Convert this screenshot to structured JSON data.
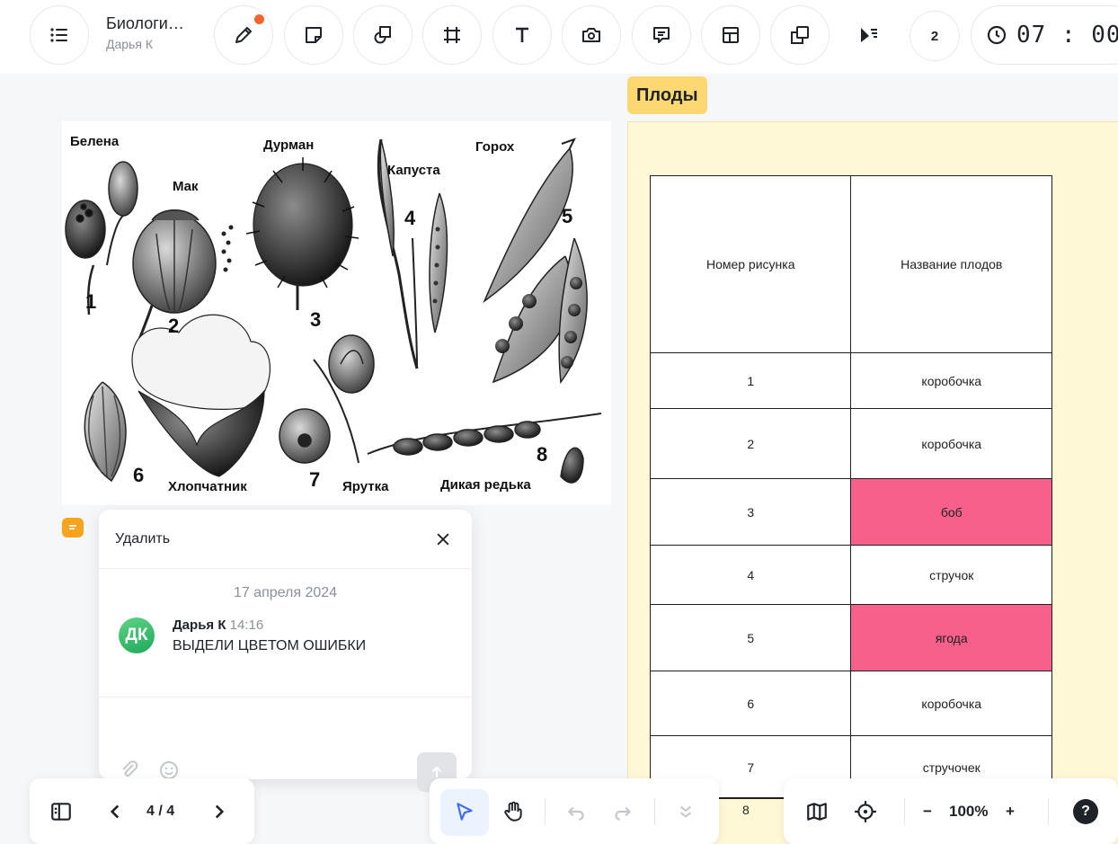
{
  "document": {
    "title": "Биологи…",
    "author": "Дарья К"
  },
  "toolbar": {
    "icons": [
      "menu-icon",
      "pen-icon",
      "sticky-note-icon",
      "shapes-icon",
      "frame-icon",
      "text-icon",
      "camera-icon",
      "comment-icon",
      "table-icon",
      "duplicate-icon",
      "presentation-icon"
    ],
    "count": "2",
    "timer": "07 : 00"
  },
  "image": {
    "labels": {
      "belena": "Белена",
      "mak": "Мак",
      "durman": "Дурман",
      "kapusta": "Капуста",
      "gorokh": "Горох",
      "khlopchatnik": "Хлопчатник",
      "yarutka": "Ярутка",
      "dikaya_redka": "Дикая редька"
    },
    "numbers": [
      "1",
      "2",
      "3",
      "4",
      "5",
      "6",
      "7",
      "8"
    ]
  },
  "frame": {
    "label": "Плоды",
    "table": {
      "headers": [
        "Номер рисунка",
        "Название плодов"
      ],
      "rows": [
        {
          "num": "1",
          "name": "коробочка",
          "highlight": false
        },
        {
          "num": "2",
          "name": "коробочка",
          "highlight": false
        },
        {
          "num": "3",
          "name": "боб",
          "highlight": true
        },
        {
          "num": "4",
          "name": "стручок",
          "highlight": false
        },
        {
          "num": "5",
          "name": "ягода",
          "highlight": true
        },
        {
          "num": "6",
          "name": "коробочка",
          "highlight": false
        },
        {
          "num": "7",
          "name": "стручочек",
          "highlight": false
        }
      ],
      "next_row_num": "8",
      "highlight_color": "#f6608a"
    }
  },
  "comment": {
    "delete_label": "Удалить",
    "date": "17 апреля 2024",
    "avatar": "ДК",
    "author": "Дарья К",
    "time": "14:16",
    "text": "ВЫДЕЛИ ЦВЕТОМ ОШИБКИ"
  },
  "bottom": {
    "page": "4 / 4",
    "zoom": "100%",
    "zoom_minus": "−",
    "zoom_plus": "+",
    "help": "?"
  },
  "colors": {
    "accent": "#3d6bff",
    "frame_bg": "#fff8d6",
    "frame_label_bg": "#fdd872",
    "comment_marker": "#f7a31d"
  }
}
